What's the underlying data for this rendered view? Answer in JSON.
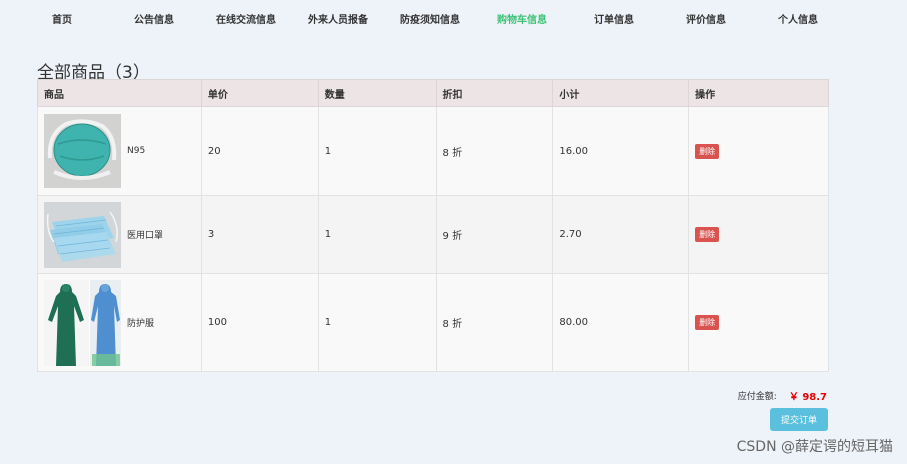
{
  "nav": {
    "items": [
      {
        "label": "首页",
        "active": false
      },
      {
        "label": "公告信息",
        "active": false
      },
      {
        "label": "在线交流信息",
        "active": false
      },
      {
        "label": "外来人员报备",
        "active": false
      },
      {
        "label": "防疫须知信息",
        "active": false
      },
      {
        "label": "购物车信息",
        "active": true
      },
      {
        "label": "订单信息",
        "active": false
      },
      {
        "label": "评价信息",
        "active": false
      },
      {
        "label": "个人信息",
        "active": false
      }
    ],
    "active_color": "#3cc277"
  },
  "page_title": "全部商品（3）",
  "table": {
    "headers": [
      "商品",
      "单价",
      "数量",
      "折扣",
      "小计",
      "操作"
    ],
    "rows": [
      {
        "name": "N95",
        "price": "20",
        "qty": "1",
        "discount": "8 折",
        "subtotal": "16.00",
        "action": "删除",
        "image": "n95-mask"
      },
      {
        "name": "医用口罩",
        "price": "3",
        "qty": "1",
        "discount": "9 折",
        "subtotal": "2.70",
        "action": "删除",
        "image": "medical-masks"
      },
      {
        "name": "防护服",
        "price": "100",
        "qty": "1",
        "discount": "8 折",
        "subtotal": "80.00",
        "action": "删除",
        "image": "protective-suits"
      }
    ]
  },
  "total": {
    "label": "应付金额:",
    "value": "￥ 98.7"
  },
  "submit_label": "提交订单",
  "watermark": "CSDN @薛定谔的短耳猫",
  "colors": {
    "delete": "#d9534f",
    "submit": "#5bc0de",
    "total": "#e60000",
    "header_bg": "#ede5e5"
  }
}
